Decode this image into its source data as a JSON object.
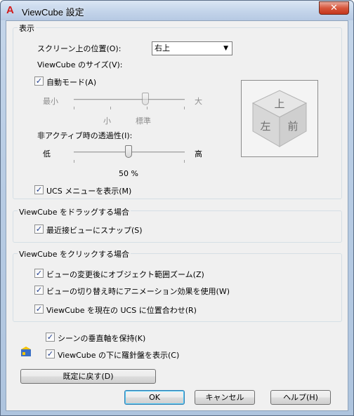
{
  "window": {
    "title": "ViewCube 設定",
    "app_icon_letter": "A",
    "close_glyph": "✕"
  },
  "display": {
    "group_title": "表示",
    "position_label": "スクリーン上の位置(O):",
    "position_value": "右上",
    "size_label": "ViewCube のサイズ(V):",
    "auto_mode_label": "自動モード(A)",
    "auto_mode_checked": true,
    "size_slider": {
      "min_label": "最小",
      "max_label": "大",
      "small_label": "小",
      "standard_label": "標準",
      "level": 0.75
    },
    "opacity_label": "非アクティブ時の透過性(I):",
    "opacity_slider": {
      "low_label": "低",
      "high_label": "高",
      "level": 0.5
    },
    "opacity_value": "50 %",
    "ucs_menu_label": "UCS メニューを表示(M)",
    "ucs_menu_checked": true,
    "cube_faces": {
      "top": "上",
      "left": "左",
      "front": "前"
    }
  },
  "drag": {
    "group_title": "ViewCube をドラッグする場合",
    "snap_label": "最近接ビューにスナップ(S)",
    "snap_checked": true
  },
  "click": {
    "group_title": "ViewCube をクリックする場合",
    "zoom_label": "ビューの変更後にオブジェクト範囲ズーム(Z)",
    "zoom_checked": true,
    "anim_label": "ビューの切り替え時にアニメーション効果を使用(W)",
    "anim_checked": true,
    "ucs_align_label": "ViewCube を現在の UCS に位置合わせ(R)",
    "ucs_align_checked": true
  },
  "extra": {
    "keep_up_label": "シーンの垂直軸を保持(K)",
    "keep_up_checked": true,
    "compass_label": "ViewCube の下に羅針盤を表示(C)",
    "compass_checked": true
  },
  "buttons": {
    "restore": "既定に戻す(D)",
    "ok": "OK",
    "cancel": "キャンセル",
    "help": "ヘルプ(H)"
  }
}
